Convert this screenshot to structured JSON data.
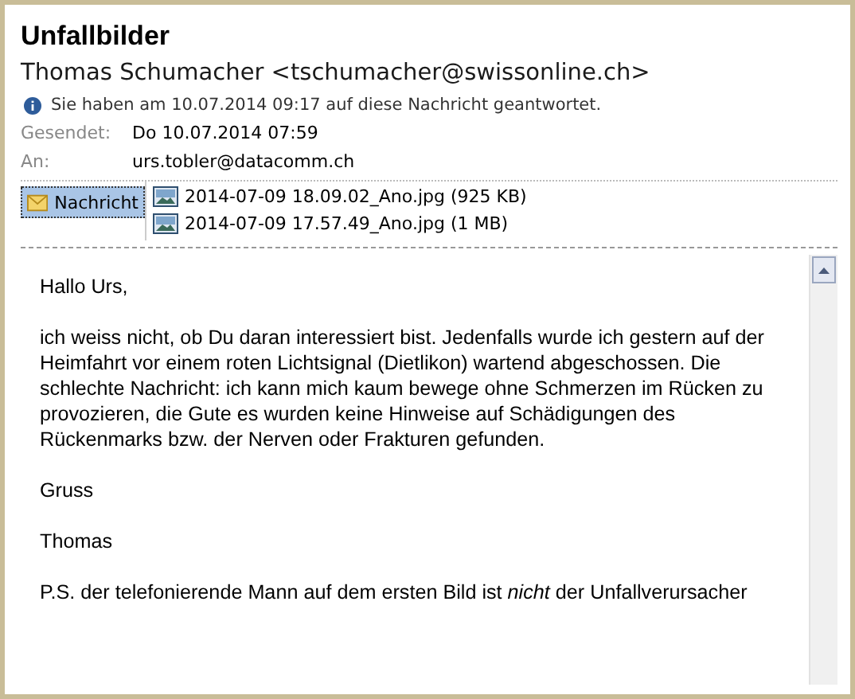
{
  "subject": "Unfallbilder",
  "sender": "Thomas Schumacher <tschumacher@swissonline.ch>",
  "reply_notice": "Sie haben am 10.07.2014 09:17 auf diese Nachricht geantwortet.",
  "headers": [
    {
      "label": "Gesendet:",
      "value": "Do 10.07.2014 07:59"
    },
    {
      "label": "An:",
      "value": "urs.tobler@datacomm.ch"
    }
  ],
  "message_tab": {
    "label": "Nachricht",
    "selected": true
  },
  "attachments": [
    {
      "name": "2014-07-09 18.09.02_Ano.jpg (925 KB)"
    },
    {
      "name": "2014-07-09 17.57.49_Ano.jpg (1 MB)"
    }
  ],
  "body": [
    "Hallo Urs,",
    "ich weiss nicht, ob Du daran interessiert bist. Jedenfalls wurde ich gestern auf der Heimfahrt vor einem roten Lichtsignal (Dietlikon) wartend abgeschossen. Die schlechte Nachricht: ich kann mich kaum bewege ohne Schmerzen im Rücken zu provozieren, die Gute es wurden keine Hinweise auf Schädigungen des Rückenmarks bzw. der Nerven oder Frakturen gefunden.",
    "Gruss",
    "Thomas",
    "P.S. der telefonierende Mann auf dem ersten Bild ist *nicht* der Unfallverursacher"
  ]
}
